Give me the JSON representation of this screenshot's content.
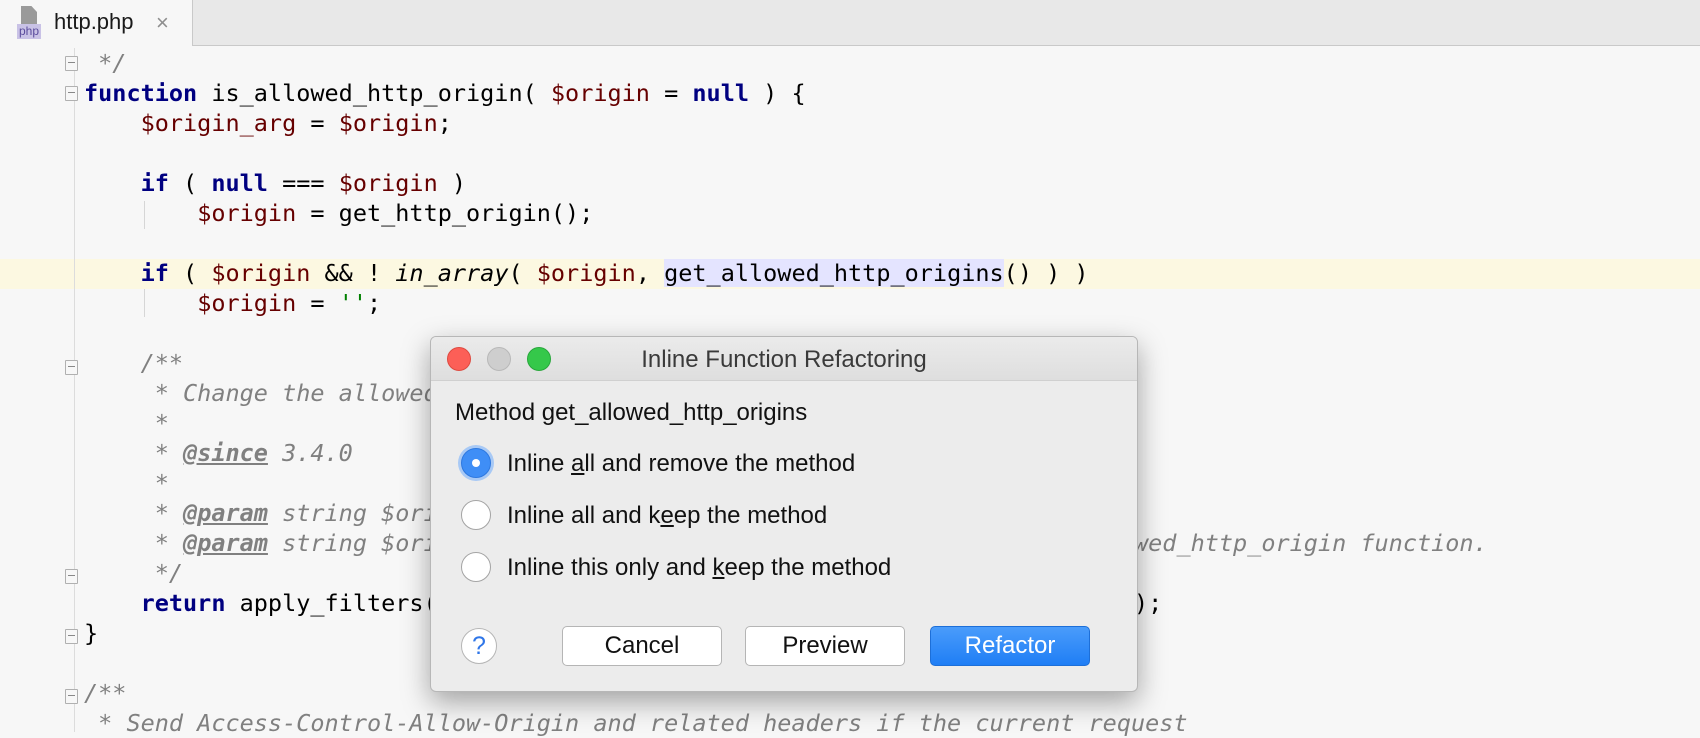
{
  "tab": {
    "badge": "php",
    "title": "http.php",
    "close": "×"
  },
  "code": {
    "l0": " */",
    "l1": {
      "kw": "function",
      "name": " is_allowed_http_origin( ",
      "var": "$origin",
      "eq": " = ",
      "null": "null",
      "rest": " ) {"
    },
    "l2": {
      "indent": "    ",
      "v1": "$origin_arg",
      "eq": " = ",
      "v2": "$origin",
      "end": ";"
    },
    "l4": {
      "indent": "    ",
      "kw": "if",
      "p1": " ( ",
      "null": "null",
      "op": " === ",
      "var": "$origin",
      "p2": " )"
    },
    "l5": {
      "indent": "        ",
      "var": "$origin",
      "rest": " = get_http_origin();"
    },
    "l7": {
      "indent": "    ",
      "kw": "if",
      "p1": " ( ",
      "v1": "$origin",
      "op": " && ! ",
      "fn": "in_array",
      "p2": "( ",
      "v2": "$origin",
      "comma": ", ",
      "usage": "get_allowed_http_origins",
      "rest": "() ) )"
    },
    "l8": {
      "indent": "        ",
      "var": "$origin",
      "eq": " = ",
      "str": "''",
      "end": ";"
    },
    "l10": "    /**",
    "l11": "     * Change the allowed",
    "l12": "     *",
    "l13": {
      "pre": "     * ",
      "tag": "@since",
      "rest": " 3.4.0"
    },
    "l14": "     *",
    "l15": {
      "pre": "     * ",
      "tag": "@param",
      "rest": " string $ori"
    },
    "l16": {
      "pre": "     * ",
      "tag": "@param",
      "rest": " string $ori",
      "tail": "wed_http_origin function."
    },
    "l17": "     */",
    "l18": {
      "indent": "    ",
      "kw": "return",
      "rest": " apply_filters(",
      "tail": ");"
    },
    "l19": "}",
    "l21": "/**",
    "l22": " * Send Access-Control-Allow-Origin and related headers if the current request"
  },
  "dialog": {
    "title": "Inline Function Refactoring",
    "heading": "Method get_allowed_http_origins",
    "options": [
      {
        "pre": "Inline ",
        "mn": "a",
        "post": "ll and remove the method",
        "checked": true
      },
      {
        "pre": "Inline all and k",
        "mn": "e",
        "post": "ep the method",
        "checked": false
      },
      {
        "pre": "Inline this only and ",
        "mn": "k",
        "post": "eep the method",
        "checked": false
      }
    ],
    "help": "?",
    "cancel": "Cancel",
    "preview": "Preview",
    "refactor": "Refactor"
  },
  "colors": {
    "keyword": "#000080",
    "variable": "#660000",
    "string": "#008000",
    "comment": "#808080",
    "accent": "#1f7ef5",
    "current_line": "#fcf8e1"
  }
}
